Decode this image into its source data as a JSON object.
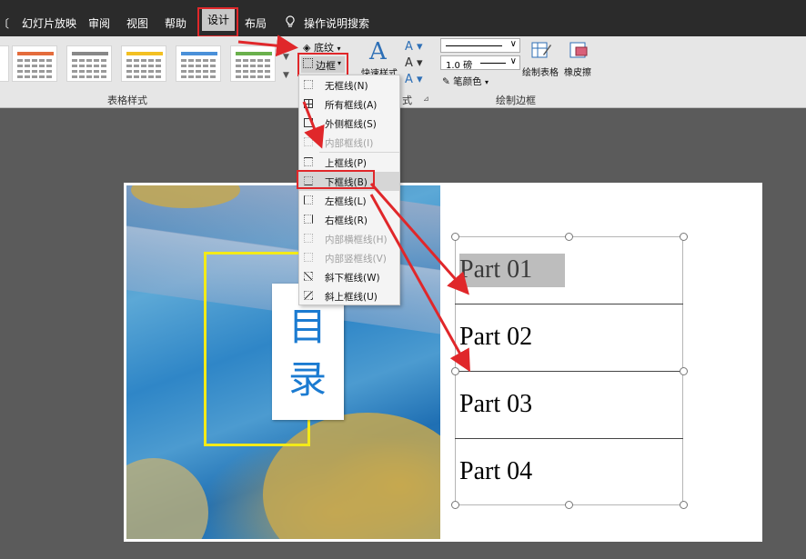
{
  "tabs": {
    "fragment": "〔",
    "slideshow": "幻灯片放映",
    "review": "审阅",
    "view": "视图",
    "help": "帮助",
    "design": "设计",
    "layout": "布局",
    "search": "操作说明搜索"
  },
  "ribbon": {
    "table_styles_label": "表格样式",
    "shading": "底纹",
    "borders": "边框",
    "quick_styles": "快速样式",
    "text_fragment": "式",
    "pen_weight": "1.0 磅",
    "pen_color": "笔颜色",
    "draw_table": "绘制表格",
    "eraser": "橡皮擦",
    "draw_borders_label": "绘制边框"
  },
  "borders_menu": {
    "items": [
      {
        "label": "无框线(N)",
        "enabled": true
      },
      {
        "label": "所有框线(A)",
        "enabled": true
      },
      {
        "label": "外侧框线(S)",
        "enabled": true
      },
      {
        "label": "内部框线(I)",
        "enabled": false
      },
      {
        "label": "上框线(P)",
        "enabled": true
      },
      {
        "label": "下框线(B)",
        "enabled": true
      },
      {
        "label": "左框线(L)",
        "enabled": true
      },
      {
        "label": "右框线(R)",
        "enabled": true
      },
      {
        "label": "内部横框线(H)",
        "enabled": false
      },
      {
        "label": "内部竖框线(V)",
        "enabled": false
      },
      {
        "label": "斜下框线(W)",
        "enabled": true
      },
      {
        "label": "斜上框线(U)",
        "enabled": true
      }
    ]
  },
  "slide": {
    "toc_title_line1": "目",
    "toc_title_line2": "录",
    "parts": [
      "Part 01",
      "Part 02",
      "Part 03",
      "Part 04"
    ]
  },
  "colors": {
    "highlight_red": "#e0272a",
    "accent_yellow": "#f3ea18",
    "toc_blue": "#1b7bd1"
  }
}
